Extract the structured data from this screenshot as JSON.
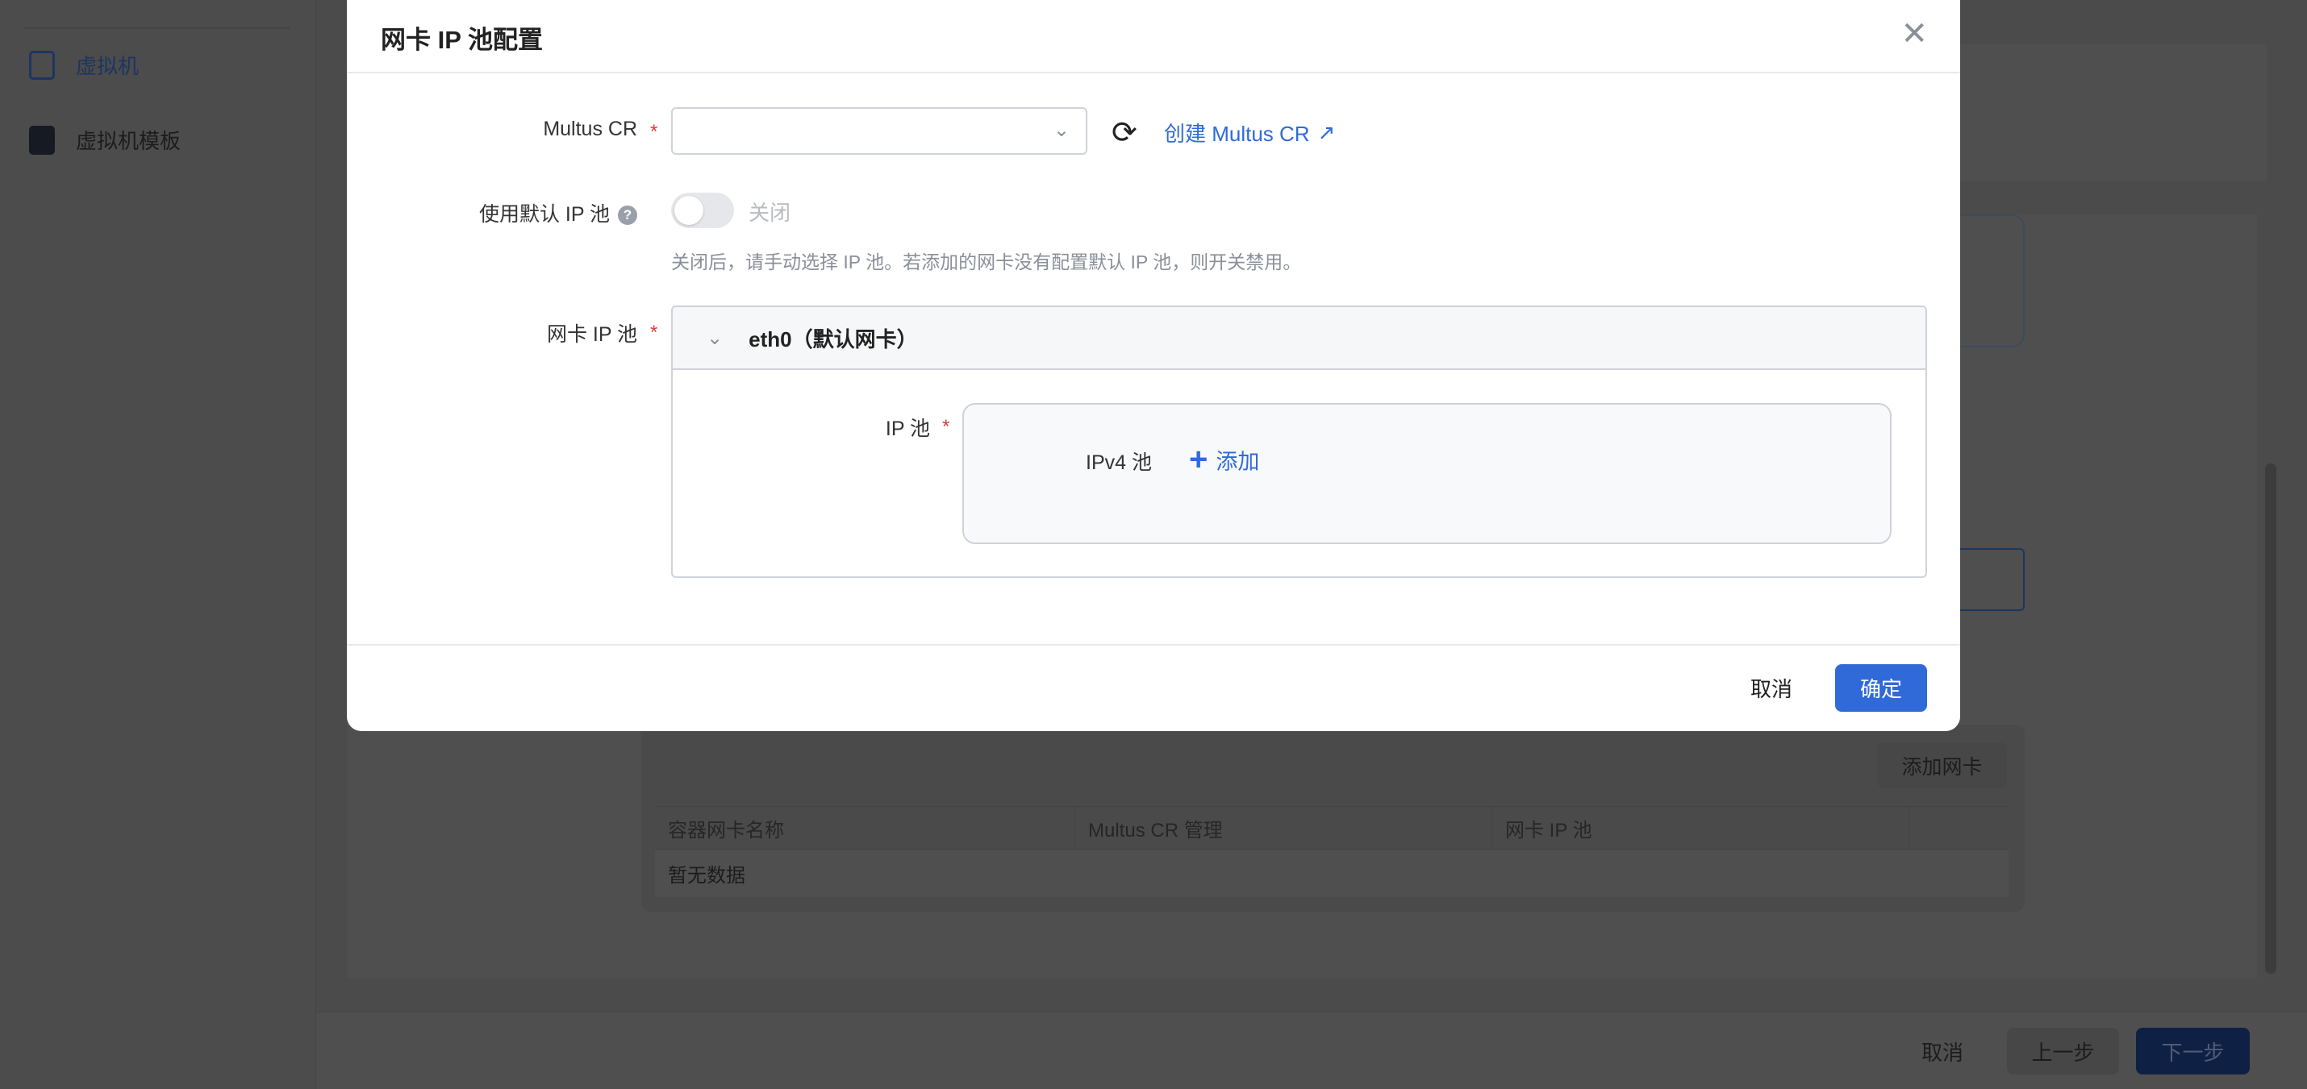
{
  "sidebar": {
    "items": [
      {
        "label": "虚拟机",
        "icon": "vm-icon"
      },
      {
        "label": "虚拟机模板",
        "icon": "vm-template-icon"
      }
    ]
  },
  "background": {
    "add_nic_button": "添加网卡",
    "table": {
      "columns": [
        "容器网卡名称",
        "Multus CR 管理",
        "网卡 IP 池",
        ""
      ],
      "empty_text": "暂无数据"
    },
    "footer": {
      "cancel": "取消",
      "prev": "上一步",
      "next": "下一步"
    }
  },
  "modal": {
    "title": "网卡 IP 池配置",
    "multus": {
      "label": "Multus CR",
      "value": "",
      "create_link": "创建 Multus CR"
    },
    "default_pool": {
      "label": "使用默认 IP 池",
      "toggle_on": false,
      "toggle_text": "关闭",
      "hint": "关闭后，请手动选择 IP 池。若添加的网卡没有配置默认 IP 池，则开关禁用。"
    },
    "nic_pool": {
      "label": "网卡 IP 池",
      "nic_title": "eth0（默认网卡）",
      "ip_pool_label": "IP 池",
      "ipv4_label": "IPv4 池",
      "add_label": "添加"
    },
    "cancel": "取消",
    "confirm": "确定"
  },
  "colors": {
    "accent": "#2f6ad8",
    "required": "#e03a3a"
  }
}
